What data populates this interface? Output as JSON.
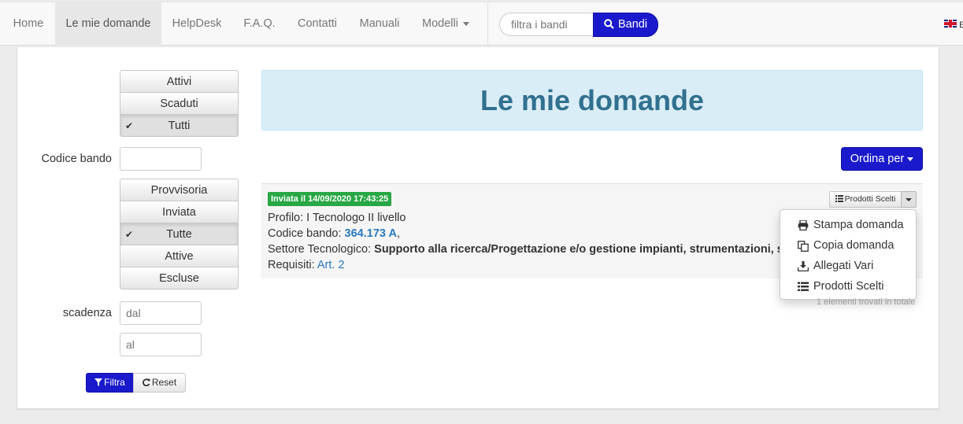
{
  "navbar": {
    "items": [
      {
        "label": "Home"
      },
      {
        "label": "Le mie domande",
        "active": true
      },
      {
        "label": "HelpDesk"
      },
      {
        "label": "F.A.Q."
      },
      {
        "label": "Contatti"
      },
      {
        "label": "Manuali"
      },
      {
        "label": "Modelli",
        "dropdown": true
      }
    ],
    "search_placeholder": "filtra i bandi",
    "search_button": "Bandi",
    "lang_label": "E",
    "lang_flag": "uk-flag-icon"
  },
  "filters": {
    "status_group": [
      "Attivi",
      "Scaduti",
      "Tutti"
    ],
    "status_selected": "Tutti",
    "codice_label": "Codice bando",
    "codice_value": "",
    "state_group": [
      "Provvisoria",
      "Inviata",
      "Tutte",
      "Attive",
      "Escluse"
    ],
    "state_selected": "Tutte",
    "scadenza_label": "scadenza",
    "dal_placeholder": "dal",
    "al_placeholder": "al",
    "filtra_label": "Filtra",
    "reset_label": "Reset"
  },
  "main": {
    "title": "Le mie domande",
    "order_button": "Ordina per",
    "application": {
      "badge": "Inviata il 14/09/2020 17:43:25",
      "profilo_label": "Profilo:",
      "profilo_value": "I Tecnologo II livello",
      "codice_label": "Codice bando:",
      "codice_value": "364.173 A",
      "codice_suffix": ",",
      "settore_label": "Settore Tecnologico:",
      "settore_value": "Supporto alla ricerca/Progettazione e/o gestione impianti, strumentazioni, servizi",
      "requisiti_label": "Requisiti:",
      "requisiti_value": "Art. 2",
      "action_button": "Prodotti Scelti",
      "menu": [
        {
          "label": "Stampa domanda",
          "icon": "print-icon"
        },
        {
          "label": "Copia domanda",
          "icon": "copy-icon"
        },
        {
          "label": "Allegati Vari",
          "icon": "download-icon"
        },
        {
          "label": "Prodotti Scelti",
          "icon": "list-icon"
        }
      ]
    },
    "total_text": "1 elementi trovati in totale"
  },
  "colors": {
    "primary": "#1a1acc",
    "badge_green": "#28a745",
    "link": "#2a7ac0",
    "jumbo_bg": "#d9edf7",
    "jumbo_text": "#31708f"
  }
}
